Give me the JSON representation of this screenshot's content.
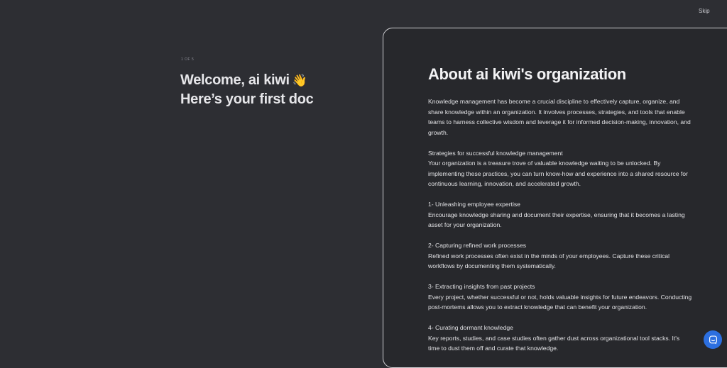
{
  "header": {
    "skip_label": "Skip"
  },
  "onboarding": {
    "step": "1 OF 5",
    "welcome_line1": "Welcome, ai kiwi",
    "wave_emoji": "👋",
    "welcome_line2": "Here’s your first doc"
  },
  "doc": {
    "title": "About ai kiwi's organization",
    "intro": "Knowledge management has become a crucial discipline to effectively capture, organize, and share knowledge within an organization. It involves processes, strategies, and tools that enable teams to harness collective wisdom and leverage it for informed decision-making, innovation, and growth.",
    "sections": [
      {
        "heading": "Strategies for successful knowledge management",
        "body": "Your organization is a treasure trove of valuable knowledge waiting to be unlocked. By implementing these practices, you can turn know-how and experience into a shared resource for continuous learning, innovation, and accelerated growth."
      },
      {
        "heading": "1- Unleashing employee expertise",
        "body": "Encourage knowledge sharing and document their expertise, ensuring that it becomes a lasting asset for your organization."
      },
      {
        "heading": "2- Capturing refined work processes",
        "body": "Refined work processes often exist in the minds of your employees. Capture these critical workflows by documenting them systematically."
      },
      {
        "heading": "3- Extracting insights from past projects",
        "body": "Every project, whether successful or not, holds valuable insights for future endeavors. Conducting post-mortems allows you to extract knowledge that can benefit your organization."
      },
      {
        "heading": "4- Curating dormant knowledge",
        "body": "Key reports, studies, and case studies often gather dust across organizational tool stacks. It's time to dust them off and curate that knowledge."
      }
    ]
  },
  "chat": {
    "icon": "chat-bubble-icon",
    "color": "#2c6fe0"
  }
}
